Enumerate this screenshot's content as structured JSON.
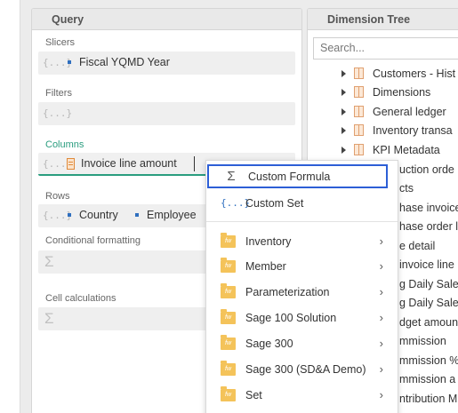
{
  "query": {
    "title": "Query",
    "slicers": {
      "label": "Slicers",
      "items": [
        "Fiscal YQMD Year"
      ]
    },
    "filters": {
      "label": "Filters"
    },
    "columns": {
      "label": "Columns",
      "items": [
        "Invoice line amount"
      ]
    },
    "rows": {
      "label": "Rows",
      "items": [
        "Country",
        "Employee"
      ]
    },
    "conditional_formatting": {
      "label": "Conditional formatting"
    },
    "cell_calculations": {
      "label": "Cell calculations"
    },
    "set_icon_text": "{...}"
  },
  "dimension_tree": {
    "title": "Dimension Tree",
    "search_placeholder": "Search...",
    "items": [
      "Customers - Hist",
      "Dimensions",
      "General ledger",
      "Inventory transa",
      "KPI Metadata",
      "uction orde",
      "cts",
      "hase invoice",
      "hase order l",
      "e detail",
      "invoice line",
      "g Daily Sales",
      "g Daily Sales",
      "dget amoun",
      "mmission",
      "mmission %",
      "mmission a",
      "ntribution M"
    ]
  },
  "context_menu": {
    "custom_formula": "Custom Formula",
    "custom_set": "Custom Set",
    "set_icon_text": "{...}",
    "folder_icon_text": "fw",
    "folders": [
      "Inventory",
      "Member",
      "Parameterization",
      "Sage 100 Solution",
      "Sage 300",
      "Sage 300 (SD&A Demo)",
      "Set"
    ]
  },
  "colors": {
    "accent_teal": "#2a9d7f",
    "highlight_blue": "#2d5fd6",
    "folder_yellow": "#f4c35a"
  }
}
